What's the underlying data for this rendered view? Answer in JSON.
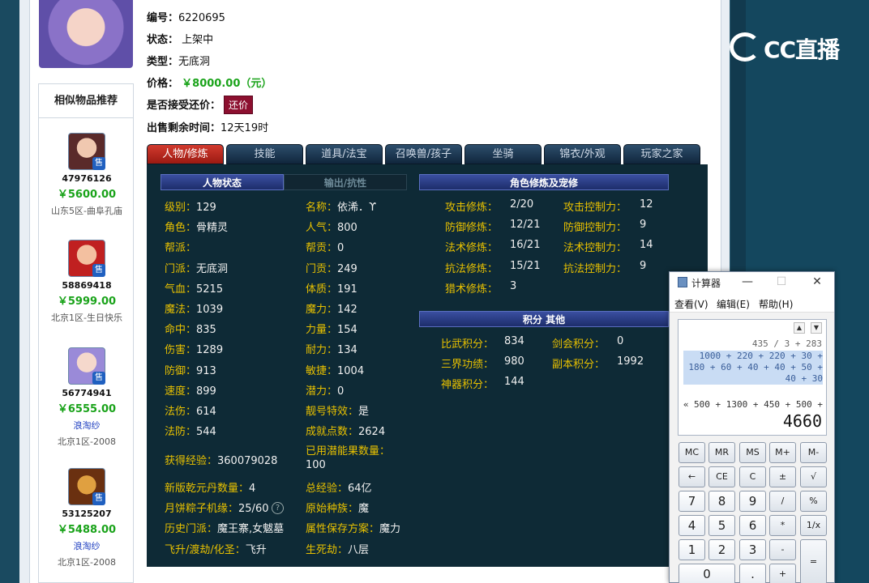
{
  "item": {
    "id_label": "编号：",
    "id": "6220695",
    "status_label": "状态：",
    "status": "上架中",
    "type_label": "类型：",
    "type": "无底洞",
    "price_label": "价格：",
    "price": "￥8000.00（元）",
    "counter_label": "是否接受还价：",
    "counter_btn": "还价",
    "remaining_label": "出售剩余时间：",
    "remaining": "12天19时"
  },
  "similar": {
    "title": "相似物品推荐",
    "items": [
      {
        "id": "47976126",
        "price": "￥5600.00",
        "server": "山东5区-曲阜孔庙",
        "badge": "售"
      },
      {
        "id": "58869418",
        "price": "￥5999.00",
        "server": "北京1区-生日快乐",
        "badge": "售"
      },
      {
        "id": "56774941",
        "price": "￥6555.00",
        "seller": "浪淘纱",
        "server": "北京1区-2008",
        "badge": "售"
      },
      {
        "id": "53125207",
        "price": "￥5488.00",
        "seller": "浪淘纱",
        "server": "北京1区-2008",
        "badge": "售"
      }
    ]
  },
  "tabs": [
    "人物/修炼",
    "技能",
    "道具/法宝",
    "召唤兽/孩子",
    "坐骑",
    "锦衣/外观",
    "玩家之家"
  ],
  "panel": {
    "status_tab": "人物状态",
    "resist_tab": "输出/抗性",
    "cultivation_title": "角色修炼及宠修",
    "points_title": "积分  其他",
    "left_col": [
      {
        "k": "级别：",
        "v": "129"
      },
      {
        "k": "角色：",
        "v": "骨精灵"
      },
      {
        "k": "帮派：",
        "v": ""
      },
      {
        "k": "门派：",
        "v": "无底洞"
      },
      {
        "k": "气血：",
        "v": "5215"
      },
      {
        "k": "魔法：",
        "v": "1039"
      },
      {
        "k": "命中：",
        "v": "835"
      },
      {
        "k": "伤害：",
        "v": "1289"
      },
      {
        "k": "防御：",
        "v": "913"
      },
      {
        "k": "速度：",
        "v": "899"
      },
      {
        "k": "法伤：",
        "v": "614"
      },
      {
        "k": "法防：",
        "v": "544"
      }
    ],
    "mid_col": [
      {
        "k": "名称：",
        "v": "依浠．ϒ"
      },
      {
        "k": "人气：",
        "v": "800"
      },
      {
        "k": "帮贡：",
        "v": "0"
      },
      {
        "k": "门贡：",
        "v": "249"
      },
      {
        "k": "体质：",
        "v": "191"
      },
      {
        "k": "魔力：",
        "v": "142"
      },
      {
        "k": "力量：",
        "v": "154"
      },
      {
        "k": "耐力：",
        "v": "134"
      },
      {
        "k": "敏捷：",
        "v": "1004"
      },
      {
        "k": "潜力：",
        "v": "0"
      },
      {
        "k": "靓号特效：",
        "v": "是"
      },
      {
        "k": "成就点数：",
        "v": "2624"
      }
    ],
    "exp": {
      "k": "获得经验：",
      "v": "360079028"
    },
    "used_potential": {
      "k": "已用潜能果数量：",
      "v": "100"
    },
    "bottom_left": [
      {
        "k": "新版乾元丹数量：",
        "v": "4"
      },
      {
        "k": "月饼粽子机缘：",
        "v": "25/60"
      },
      {
        "k": "历史门派：",
        "v": "魔王寨,女魃墓"
      },
      {
        "k": "飞升/渡劫/化圣：",
        "v": "飞升"
      }
    ],
    "bottom_mid": [
      {
        "k": "总经验：",
        "v": "64亿"
      },
      {
        "k": "原始种族：",
        "v": "魔"
      },
      {
        "k": "属性保存方案：",
        "v": "魔力"
      },
      {
        "k": "生死劫：",
        "v": "八层"
      }
    ],
    "cult_left": [
      {
        "k": "攻击修炼：",
        "v": "2/20"
      },
      {
        "k": "防御修炼：",
        "v": "12/21"
      },
      {
        "k": "法术修炼：",
        "v": "16/21"
      },
      {
        "k": "抗法修炼：",
        "v": "15/21"
      },
      {
        "k": "猎术修炼：",
        "v": "3"
      }
    ],
    "cult_right": [
      {
        "k": "攻击控制力：",
        "v": "12"
      },
      {
        "k": "防御控制力：",
        "v": "9"
      },
      {
        "k": "法术控制力：",
        "v": "14"
      },
      {
        "k": "抗法控制力：",
        "v": "9"
      }
    ],
    "points_left": [
      {
        "k": "比武积分：",
        "v": "834"
      },
      {
        "k": "三界功绩：",
        "v": "980"
      },
      {
        "k": "神器积分：",
        "v": "144"
      }
    ],
    "points_right": [
      {
        "k": "剑会积分：",
        "v": "0"
      },
      {
        "k": "副本积分：",
        "v": "1992"
      }
    ]
  },
  "calculator": {
    "title": "计算器",
    "menu": [
      "查看(V)",
      "编辑(E)",
      "帮助(H)"
    ],
    "history1": "435 / 3 + 283",
    "hl1": "1000 + 220 + 220 + 30 +",
    "hl2": "180 + 60 + 40 + 40 + 50 +",
    "hl3": "40 + 30",
    "expr": "« 500 + 1300 + 450 + 500 +",
    "result": "4660",
    "buttons": [
      "MC",
      "MR",
      "MS",
      "M+",
      "M-",
      "←",
      "CE",
      "C",
      "±",
      "√",
      "7",
      "8",
      "9",
      "/",
      "%",
      "4",
      "5",
      "6",
      "*",
      "1/x",
      "1",
      "2",
      "3",
      "-",
      "=",
      "0",
      ".",
      "+"
    ]
  },
  "brand": {
    "logo_text": "CC直播"
  }
}
